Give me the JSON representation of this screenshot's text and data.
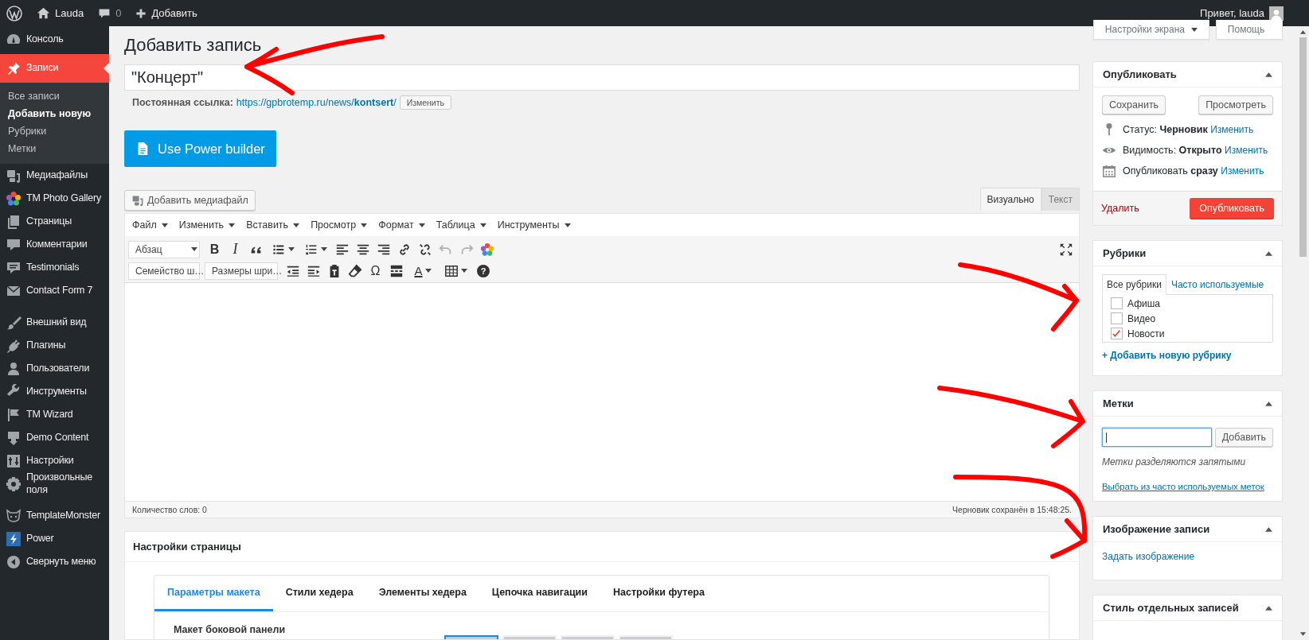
{
  "admin_bar": {
    "site": "Lauda",
    "comments": "0",
    "new": "Добавить",
    "greeting": "Привет, lauda"
  },
  "sidebar": {
    "items": [
      {
        "kind": "item",
        "label": "Консоль",
        "selected": false
      },
      {
        "kind": "item",
        "label": "Записи",
        "selected": true,
        "children": [
          {
            "label": "Все записи",
            "selected": false
          },
          {
            "label": "Добавить новую",
            "selected": true
          },
          {
            "label": "Рубрики",
            "selected": false
          },
          {
            "label": "Метки",
            "selected": false
          }
        ]
      },
      {
        "kind": "item",
        "label": "Медиафайлы",
        "selected": false
      },
      {
        "kind": "item",
        "label": "TM Photo Gallery",
        "selected": false
      },
      {
        "kind": "item",
        "label": "Страницы",
        "selected": false
      },
      {
        "kind": "item",
        "label": "Комментарии",
        "selected": false
      },
      {
        "kind": "item",
        "label": "Testimonials",
        "selected": false
      },
      {
        "kind": "item",
        "label": "Contact Form 7",
        "selected": false
      },
      {
        "kind": "separator"
      },
      {
        "kind": "item",
        "label": "Внешний вид",
        "selected": false
      },
      {
        "kind": "item",
        "label": "Плагины",
        "selected": false
      },
      {
        "kind": "item",
        "label": "Пользователи",
        "selected": false
      },
      {
        "kind": "item",
        "label": "Инструменты",
        "selected": false
      },
      {
        "kind": "item",
        "label": "TM Wizard",
        "selected": false
      },
      {
        "kind": "item",
        "label": "Demo Content",
        "selected": false
      },
      {
        "kind": "item",
        "label": "Настройки",
        "selected": false
      },
      {
        "kind": "item",
        "label": "Произвольные поля",
        "selected": false
      },
      {
        "kind": "separator"
      },
      {
        "kind": "item",
        "label": "TemplateMonster",
        "selected": false
      },
      {
        "kind": "item",
        "label": "Power",
        "selected": false
      },
      {
        "kind": "item",
        "label": "Свернуть меню",
        "selected": false
      }
    ]
  },
  "screen_buttons": [
    "Настройки экрана",
    "Помощь"
  ],
  "page_title": "Добавить запись",
  "post_title": "\"Концерт\"",
  "permalink": {
    "label": "Постоянная ссылка:",
    "url": "https://gpbrotemp.ru/news/**kontsert**/",
    "button": "Изменить"
  },
  "builder_button": "Use Power builder",
  "media_button": "Добавить медиафайл",
  "editor": {
    "tabs": [
      {
        "label": "Визуально",
        "selected": true
      },
      {
        "label": "Текст",
        "selected": false
      }
    ],
    "menu": [
      "Файл",
      "Изменить",
      "Вставить",
      "Просмотр",
      "Формат",
      "Таблица",
      "Инструменты"
    ],
    "toolbar_1": [
      {
        "kind": "select",
        "label": "Абзац",
        "disabled": false
      },
      {
        "kind": "bold",
        "label": "B",
        "disabled": false
      },
      {
        "kind": "italic",
        "label": "I",
        "disabled": false
      },
      {
        "kind": "quote",
        "disabled": false
      },
      {
        "kind": "bullet-list",
        "disabled": false
      },
      {
        "kind": "numbered-list",
        "disabled": false
      },
      {
        "kind": "align-left",
        "disabled": false
      },
      {
        "kind": "align-center",
        "disabled": false
      },
      {
        "kind": "align-right",
        "disabled": false
      },
      {
        "kind": "link",
        "disabled": false
      },
      {
        "kind": "unlink",
        "disabled": false
      },
      {
        "kind": "undo",
        "disabled": true
      },
      {
        "kind": "redo",
        "disabled": true
      },
      {
        "kind": "flower",
        "disabled": false
      },
      {
        "kind": "fullscreen",
        "disabled": false
      }
    ],
    "toolbar_2": [
      {
        "kind": "select",
        "label": "Семейство ш…"
      },
      {
        "kind": "select",
        "label": "Размеры шри…"
      },
      {
        "kind": "outdent"
      },
      {
        "kind": "indent"
      },
      {
        "kind": "paste-text"
      },
      {
        "kind": "eraser"
      },
      {
        "kind": "symbol",
        "label": "Ω"
      },
      {
        "kind": "more-break"
      },
      {
        "kind": "text-color",
        "label": "A"
      },
      {
        "kind": "table"
      },
      {
        "kind": "help",
        "label": "?"
      }
    ],
    "word_count": "Количество слов: 0",
    "autosave": "Черновик сохранён в 15:48:25."
  },
  "page_settings": {
    "title": "Настройки страницы",
    "tabs": [
      {
        "label": "Параметры макета",
        "selected": true
      },
      {
        "label": "Стили хедера",
        "selected": false
      },
      {
        "label": "Элементы хедера",
        "selected": false
      },
      {
        "label": "Цепочка навигации",
        "selected": false
      },
      {
        "label": "Настройки футера",
        "selected": false
      }
    ],
    "field_label": "Макет боковой панели",
    "layout_options": [
      {
        "selected": true
      },
      {
        "selected": false
      },
      {
        "selected": false
      },
      {
        "selected": false
      }
    ]
  },
  "publish": {
    "title": "Опубликовать",
    "save": "Сохранить",
    "preview": "Просмотреть",
    "rows": [
      {
        "label": "Статус:",
        "value": "Черновик",
        "link": "Изменить"
      },
      {
        "label": "Видимость:",
        "value": "Открыто",
        "link": "Изменить"
      },
      {
        "label": "Опубликовать",
        "value": "сразу",
        "link": "Изменить"
      }
    ],
    "delete": "Удалить",
    "publish": "Опубликовать"
  },
  "categories": {
    "title": "Рубрики",
    "tabs": [
      {
        "label": "Все рубрики",
        "selected": true
      },
      {
        "label": "Часто используемые",
        "selected": false
      }
    ],
    "items": [
      {
        "label": "Афиша",
        "checked": false
      },
      {
        "label": "Видео",
        "checked": false
      },
      {
        "label": "Новости",
        "checked": true
      }
    ],
    "add_link": "+ Добавить новую рубрику"
  },
  "tags": {
    "title": "Метки",
    "button": "Добавить",
    "hint": "Метки разделяются запятыми",
    "link": "Выбрать из часто используемых меток"
  },
  "featured_image": {
    "title": "Изображение записи",
    "link": "Задать изображение"
  },
  "post_style": {
    "title": "Стиль отдельных записей"
  }
}
